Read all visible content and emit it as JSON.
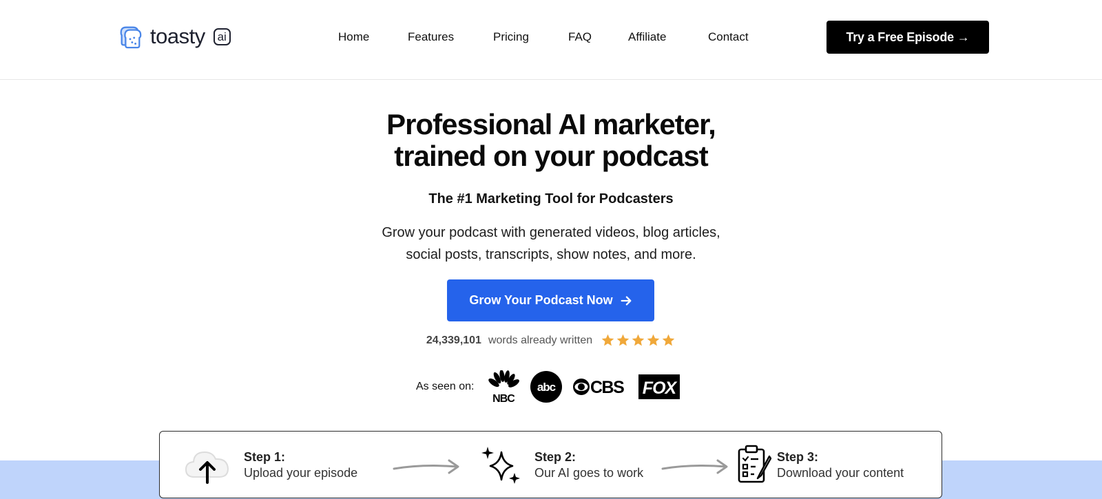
{
  "brand": {
    "name": "toasty",
    "badge": "ai"
  },
  "nav": {
    "items": [
      {
        "label": "Home"
      },
      {
        "label": "Features"
      },
      {
        "label": "Pricing"
      },
      {
        "label": "FAQ"
      },
      {
        "label": "Affiliate"
      },
      {
        "label": "Contact"
      }
    ],
    "cta_label": "Try a Free Episode →"
  },
  "hero": {
    "title_line1": "Professional AI marketer,",
    "title_line2": "trained on your podcast",
    "subtitle": "The #1 Marketing Tool for Podcasters",
    "desc_line1": "Grow your podcast with generated videos, blog articles,",
    "desc_line2": "social posts, transcripts, show notes, and more.",
    "cta_label": "Grow Your Podcast Now"
  },
  "stats": {
    "count": "24,339,101",
    "label": "words already written",
    "rating": 5,
    "star_color": "#f0a83a"
  },
  "seen_on": {
    "label": "As seen on:",
    "logos": [
      "NBC",
      "abc",
      "CBS",
      "FOX"
    ]
  },
  "steps": [
    {
      "title": "Step 1:",
      "text": "Upload your episode",
      "icon": "cloud-upload-icon"
    },
    {
      "title": "Step 2:",
      "text": "Our AI goes to work",
      "icon": "sparkle-icon"
    },
    {
      "title": "Step 3:",
      "text": "Download your content",
      "icon": "clipboard-checklist-icon"
    }
  ],
  "colors": {
    "primary": "#2563eb",
    "brand_blue": "#4a86e8",
    "band": "#bfd4fb",
    "dark_button": "#000000"
  }
}
